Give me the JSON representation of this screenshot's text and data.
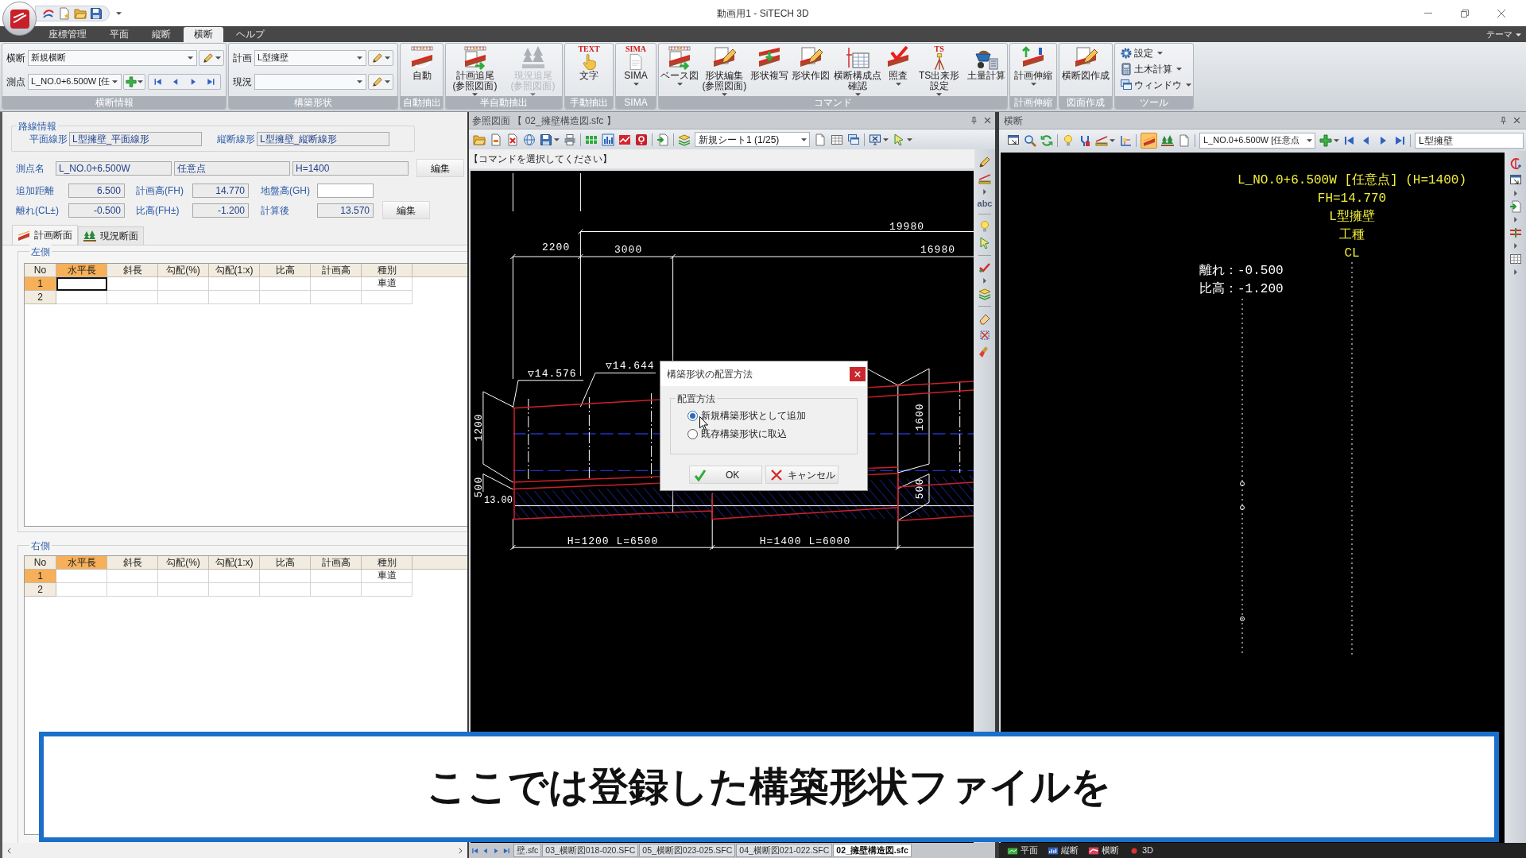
{
  "window": {
    "title": "動画用1 - SiTECH 3D"
  },
  "menu": {
    "tabs": [
      {
        "label": "座標管理",
        "selected": false
      },
      {
        "label": "平面",
        "selected": false
      },
      {
        "label": "縦断",
        "selected": false
      },
      {
        "label": "横断",
        "selected": true
      },
      {
        "label": "ヘルプ",
        "selected": false
      }
    ],
    "theme": "テーマ"
  },
  "ribbon": [
    {
      "kind": "fields",
      "title": "横断情報",
      "rows": [
        {
          "kind": "edit",
          "label": "横断",
          "value": "新規横断"
        },
        {
          "kind": "navigate",
          "label": "測点",
          "value": "L_NO.0+6.500W [任"
        }
      ]
    },
    {
      "kind": "fields",
      "title": "構築形状",
      "rows": [
        {
          "kind": "edit",
          "label": "計画",
          "value": "L型擁壁"
        },
        {
          "kind": "edit",
          "label": "現況"
        }
      ]
    },
    {
      "kind": "large",
      "title": "自動抽出",
      "buttons": [
        {
          "label": "自動",
          "menu": false
        }
      ]
    },
    {
      "kind": "large",
      "title": "半自動抽出",
      "buttons": [
        {
          "label": "計画追尾\n(参照図面)",
          "menu": true,
          "disabled": false
        },
        {
          "label": "現況追尾\n(参照図面)",
          "menu": true,
          "disabled": true
        }
      ]
    },
    {
      "kind": "large",
      "title": "手動抽出",
      "buttons": [
        {
          "label": "文字",
          "icon_text": "TEXT",
          "menu": false
        }
      ]
    },
    {
      "kind": "large",
      "title": "SIMA",
      "buttons": [
        {
          "label": "SIMA",
          "icon_text": "SIMA",
          "menu": true
        }
      ]
    },
    {
      "kind": "large",
      "title": "コマンド",
      "buttons": [
        {
          "label": "ベース図",
          "menu": true
        },
        {
          "label": "形状編集\n(参照図面)",
          "menu": true
        },
        {
          "label": "形状複写",
          "menu": false
        },
        {
          "label": "形状作図",
          "menu": false
        },
        {
          "label": "横断構成点確認",
          "menu": true
        },
        {
          "label": "照査",
          "menu": true
        },
        {
          "label": "TS出来形設定",
          "icon_text": "TS",
          "menu": true
        },
        {
          "label": "土量計算",
          "menu": false
        }
      ]
    },
    {
      "kind": "large",
      "title": "計画伸縮",
      "buttons": [
        {
          "label": "計画伸縮",
          "menu": true
        }
      ]
    },
    {
      "kind": "large",
      "title": "図面作成",
      "buttons": [
        {
          "label": "横断図作成",
          "menu": false
        }
      ]
    },
    {
      "kind": "small",
      "title": "ツール",
      "buttons": [
        {
          "label": "設定",
          "menu": true
        },
        {
          "label": "土木計算",
          "menu": true
        },
        {
          "label": "ウィンドウ",
          "menu": true
        }
      ]
    }
  ],
  "route_info": {
    "title": "路線情報",
    "fields": [
      {
        "label": "平面線形",
        "value": "L型擁壁_平面線形"
      },
      {
        "label": "縦断線形",
        "value": "L型擁壁_縦断線形"
      }
    ]
  },
  "station": {
    "label": "測点名",
    "values": [
      "L_NO.0+6.500W",
      "任意点",
      "H=1400"
    ],
    "button": "編集"
  },
  "measures": [
    {
      "fields": [
        {
          "label": "追加距離",
          "value": "6.500",
          "readonly": true
        },
        {
          "label": "計画高(FH)",
          "value": "14.770",
          "readonly": true
        },
        {
          "label": "地盤高(GH)",
          "readonly": false
        }
      ]
    },
    {
      "fields": [
        {
          "label": "離れ(CL±)",
          "value": "-0.500",
          "readonly": true
        },
        {
          "label": "比高(FH±)",
          "value": "-1.200",
          "readonly": true
        },
        {
          "label": "計算後",
          "value": "13.570",
          "readonly": true
        }
      ],
      "button": "編集"
    }
  ],
  "section_tabs": [
    {
      "label": "計画断面",
      "selected": true
    },
    {
      "label": "現況断面",
      "selected": false
    }
  ],
  "sides": [
    {
      "title": "左側",
      "columns": [
        {
          "label": "No",
          "selected": false
        },
        {
          "label": "水平長",
          "selected": true
        },
        {
          "label": "斜長",
          "selected": false
        },
        {
          "label": "勾配(%)",
          "selected": false
        },
        {
          "label": "勾配(1:x)",
          "selected": false
        },
        {
          "label": "比高",
          "selected": false
        },
        {
          "label": "計画高",
          "selected": false
        },
        {
          "label": "種別",
          "selected": false
        }
      ],
      "rows": [
        {
          "no": "1",
          "selected": true,
          "focused": true,
          "category": "車道"
        },
        {
          "no": "2",
          "selected": false,
          "focused": false
        }
      ]
    },
    {
      "title": "右側",
      "columns": [
        {
          "label": "No",
          "selected": false
        },
        {
          "label": "水平長",
          "selected": true
        },
        {
          "label": "斜長",
          "selected": false
        },
        {
          "label": "勾配(%)",
          "selected": false
        },
        {
          "label": "勾配(1:x)",
          "selected": false
        },
        {
          "label": "比高",
          "selected": false
        },
        {
          "label": "計画高",
          "selected": false
        },
        {
          "label": "種別",
          "selected": false
        }
      ],
      "rows": [
        {
          "no": "1",
          "selected": true,
          "focused": false,
          "category": "車道"
        },
        {
          "no": "2",
          "selected": false,
          "focused": false
        }
      ]
    }
  ],
  "reference_view": {
    "title": "参照図面 【 02_擁壁構造図.sfc 】",
    "sheet": "新規シート1 (1/25)",
    "prompt": "【コマンドを選択してください】",
    "side_tool_lettering": "abc",
    "drawing_labels": [
      "19980",
      "2200",
      "3000",
      "16980",
      "▽14.576",
      "▽14.644",
      "1200",
      "500",
      "13.00",
      "1600",
      "500",
      "H=1200 L=6500",
      "H=1400 L=6000"
    ]
  },
  "dialog": {
    "title": "構築形状の配置方法",
    "group": "配置方法",
    "options": [
      {
        "label": "新規構築形状として追加",
        "selected": true
      },
      {
        "label": "既存構築形状に取込",
        "selected": false
      }
    ],
    "buttons": [
      {
        "kind": "ok",
        "label": "OK"
      },
      {
        "kind": "cancel",
        "label": "キャンセル"
      }
    ]
  },
  "cross_section_view": {
    "title": "横断",
    "station": "L_NO.0+6.500W [任意点",
    "section_tool_on": true,
    "shape": "L型擁壁",
    "header_lines": [
      "L_NO.0+6.500W [任意点] (H=1400)",
      "FH=14.770",
      "L型擁壁",
      "工種",
      "CL"
    ],
    "offset_lines": [
      "離れ：-0.500",
      "比高：-1.200"
    ]
  },
  "document_tabs": [
    {
      "label": "壁.sfc",
      "selected": false
    },
    {
      "label": "03_横断図018-020.SFC",
      "selected": false
    },
    {
      "label": "05_横断図023-025.SFC",
      "selected": false
    },
    {
      "label": "04_横断図021-022.SFC",
      "selected": false
    },
    {
      "label": "02_擁壁構造図.sfc",
      "selected": true
    }
  ],
  "view_tabs": [
    {
      "label": "平面"
    },
    {
      "label": "縦断"
    },
    {
      "label": "横断"
    },
    {
      "label": "3D"
    }
  ],
  "caption": "ここでは登録した構築形状ファイルを"
}
